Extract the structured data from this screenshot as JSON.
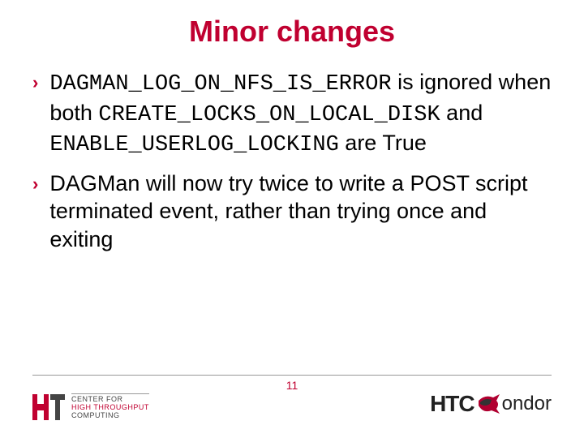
{
  "title": "Minor changes",
  "bullets": {
    "b1": {
      "seg1": "DAGMAN_LOG_ON_NFS_IS_ERROR",
      "seg2": " is ignored when both ",
      "seg3": "CREATE_LOCKS_ON_LOCAL_DISK",
      "seg4": " and ",
      "seg5": "ENABLE_USERLOG_LOCKING",
      "seg6": " are True"
    },
    "b2": "DAGMan will now try twice to write a POST script terminated event, rather than trying once and exiting"
  },
  "page_number": "11",
  "logo_left": {
    "line1": "CENTER FOR",
    "line2a": "HIGH THROUGHPUT",
    "line2b": "COMPUTING"
  },
  "logo_right": {
    "ht": "HTC",
    "ondor": "ondor"
  }
}
